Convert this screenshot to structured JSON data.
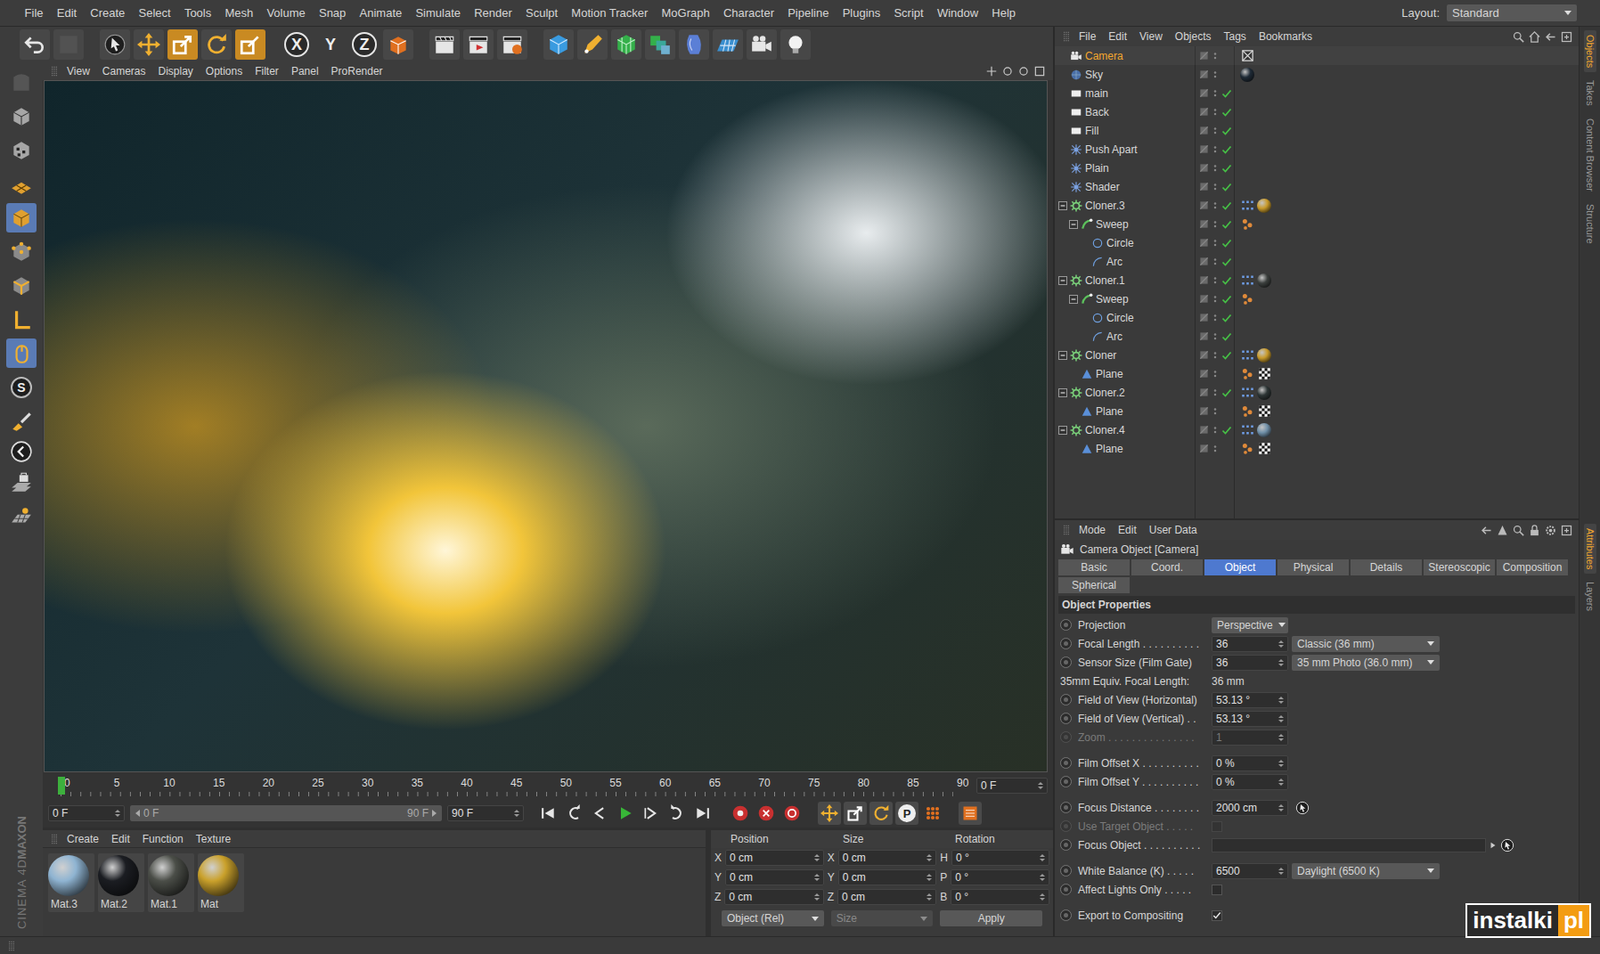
{
  "menubar": {
    "items": [
      "File",
      "Edit",
      "Create",
      "Select",
      "Tools",
      "Mesh",
      "Volume",
      "Snap",
      "Animate",
      "Simulate",
      "Render",
      "Sculpt",
      "Motion Tracker",
      "MoGraph",
      "Character",
      "Pipeline",
      "Plugins",
      "Script",
      "Window",
      "Help"
    ],
    "layout_label": "Layout:",
    "layout_value": "Standard"
  },
  "toolbar": {
    "tools": [
      {
        "highlighted": false
      },
      {
        "highlighted": false
      },
      {
        "highlighted": true
      },
      {
        "highlighted": false
      },
      {
        "highlighted": true
      }
    ],
    "axes": [
      {
        "label": "X",
        "active": true
      },
      {
        "label": "Y",
        "active": false
      },
      {
        "label": "Z",
        "active": true
      }
    ]
  },
  "left_toolbar": {
    "tools": [
      {
        "selected": false
      },
      {
        "selected": false
      },
      {
        "selected": false
      },
      {
        "selected": false
      },
      {
        "selected": true
      },
      {
        "selected": false
      },
      {
        "selected": false
      },
      {
        "selected": false
      },
      {
        "selected": true
      },
      {
        "selected": false
      },
      {
        "selected": false
      },
      {
        "selected": false
      },
      {
        "selected": false
      }
    ],
    "snap_label": "S"
  },
  "viewport": {
    "menu": [
      "View",
      "Cameras",
      "Display",
      "Options",
      "Filter",
      "Panel",
      "ProRender"
    ]
  },
  "timeline": {
    "ticks": [
      "0",
      "5",
      "10",
      "15",
      "20",
      "25",
      "30",
      "35",
      "40",
      "45",
      "50",
      "55",
      "60",
      "65",
      "70",
      "75",
      "80",
      "85",
      "90"
    ],
    "playhead": 0,
    "current_frame": "0 F"
  },
  "playback": {
    "start": "0 F",
    "range_start": "0 F",
    "range_end": "90 F",
    "end": "90 F",
    "range_level": 1,
    "param_label": "P"
  },
  "materials": {
    "menu": [
      "Create",
      "Edit",
      "Function",
      "Texture"
    ],
    "items": [
      {
        "name": "Mat.3",
        "color": "#8fb4d2"
      },
      {
        "name": "Mat.2",
        "color": "#1b1d22"
      },
      {
        "name": "Mat.1",
        "color": "#4b4e48"
      },
      {
        "name": "Mat",
        "color": "#caa12b"
      }
    ]
  },
  "coordinates": {
    "headers": [
      "Position",
      "Size",
      "Rotation"
    ],
    "rows": [
      {
        "axis": "X",
        "position": "0 cm",
        "size_axis": "X",
        "size": "0 cm",
        "rotation_axis": "H",
        "rotation": "0 °"
      },
      {
        "axis": "Y",
        "position": "0 cm",
        "size_axis": "Y",
        "size": "0 cm",
        "rotation_axis": "P",
        "rotation": "0 °"
      },
      {
        "axis": "Z",
        "position": "0 cm",
        "size_axis": "Z",
        "size": "0 cm",
        "rotation_axis": "B",
        "rotation": "0 °"
      }
    ],
    "mode": "Object (Rel)",
    "size_mode": "Size",
    "size_mode_disabled": true,
    "apply": "Apply"
  },
  "object_manager": {
    "menu": [
      "File",
      "Edit",
      "View",
      "Objects",
      "Tags",
      "Bookmarks"
    ],
    "objects": [
      {
        "name": "Camera",
        "depth": 0,
        "kind": "camera",
        "expandable": false,
        "expanded": false,
        "selected": true,
        "enabled": false,
        "tags": [
          {
            "kind": "protection"
          }
        ]
      },
      {
        "name": "Sky",
        "depth": 0,
        "kind": "sky",
        "expandable": false,
        "expanded": false,
        "selected": false,
        "enabled": false,
        "tags": [
          {
            "kind": "material",
            "color": "#1e2a36"
          }
        ]
      },
      {
        "name": "main",
        "depth": 0,
        "kind": "light",
        "expandable": false,
        "expanded": false,
        "selected": false,
        "enabled": true,
        "tags": []
      },
      {
        "name": "Back",
        "depth": 0,
        "kind": "light",
        "expandable": false,
        "expanded": false,
        "selected": false,
        "enabled": true,
        "tags": []
      },
      {
        "name": "Fill",
        "depth": 0,
        "kind": "light",
        "expandable": false,
        "expanded": false,
        "selected": false,
        "enabled": true,
        "tags": []
      },
      {
        "name": "Push Apart",
        "depth": 0,
        "kind": "effector",
        "expandable": false,
        "expanded": false,
        "selected": false,
        "enabled": true,
        "tags": []
      },
      {
        "name": "Plain",
        "depth": 0,
        "kind": "effector",
        "expandable": false,
        "expanded": false,
        "selected": false,
        "enabled": true,
        "tags": []
      },
      {
        "name": "Shader",
        "depth": 0,
        "kind": "effector",
        "expandable": false,
        "expanded": false,
        "selected": false,
        "enabled": true,
        "tags": []
      },
      {
        "name": "Cloner.3",
        "depth": 0,
        "kind": "cloner",
        "expandable": true,
        "expanded": true,
        "selected": false,
        "enabled": true,
        "tags": [
          {
            "kind": "selection"
          },
          {
            "kind": "material",
            "color": "#c89a2a"
          }
        ]
      },
      {
        "name": "Sweep",
        "depth": 1,
        "kind": "sweep",
        "expandable": true,
        "expanded": true,
        "selected": false,
        "enabled": true,
        "tags": [
          {
            "kind": "phong"
          }
        ]
      },
      {
        "name": "Circle",
        "depth": 2,
        "kind": "circle",
        "expandable": false,
        "expanded": false,
        "selected": false,
        "enabled": true,
        "tags": []
      },
      {
        "name": "Arc",
        "depth": 2,
        "kind": "arc",
        "expandable": false,
        "expanded": false,
        "selected": false,
        "enabled": true,
        "tags": []
      },
      {
        "name": "Cloner.1",
        "depth": 0,
        "kind": "cloner",
        "expandable": true,
        "expanded": true,
        "selected": false,
        "enabled": true,
        "tags": [
          {
            "kind": "selection"
          },
          {
            "kind": "material",
            "color": "#3b3f3d"
          }
        ]
      },
      {
        "name": "Sweep",
        "depth": 1,
        "kind": "sweep",
        "expandable": true,
        "expanded": true,
        "selected": false,
        "enabled": true,
        "tags": [
          {
            "kind": "phong"
          }
        ]
      },
      {
        "name": "Circle",
        "depth": 2,
        "kind": "circle",
        "expandable": false,
        "expanded": false,
        "selected": false,
        "enabled": true,
        "tags": []
      },
      {
        "name": "Arc",
        "depth": 2,
        "kind": "arc",
        "expandable": false,
        "expanded": false,
        "selected": false,
        "enabled": true,
        "tags": []
      },
      {
        "name": "Cloner",
        "depth": 0,
        "kind": "cloner",
        "expandable": true,
        "expanded": true,
        "selected": false,
        "enabled": true,
        "tags": [
          {
            "kind": "selection"
          },
          {
            "kind": "material",
            "color": "#c89a2a"
          }
        ]
      },
      {
        "name": "Plane",
        "depth": 1,
        "kind": "plane",
        "expandable": false,
        "expanded": false,
        "selected": false,
        "enabled": false,
        "tags": [
          {
            "kind": "phong"
          },
          {
            "kind": "texture"
          }
        ]
      },
      {
        "name": "Cloner.2",
        "depth": 0,
        "kind": "cloner",
        "expandable": true,
        "expanded": true,
        "selected": false,
        "enabled": true,
        "tags": [
          {
            "kind": "selection"
          },
          {
            "kind": "material",
            "color": "#2d3535"
          }
        ]
      },
      {
        "name": "Plane",
        "depth": 1,
        "kind": "plane",
        "expandable": false,
        "expanded": false,
        "selected": false,
        "enabled": false,
        "tags": [
          {
            "kind": "phong"
          },
          {
            "kind": "texture"
          }
        ]
      },
      {
        "name": "Cloner.4",
        "depth": 0,
        "kind": "cloner",
        "expandable": true,
        "expanded": true,
        "selected": false,
        "enabled": true,
        "tags": [
          {
            "kind": "selection"
          },
          {
            "kind": "material",
            "color": "#6f8fa8"
          }
        ]
      },
      {
        "name": "Plane",
        "depth": 1,
        "kind": "plane",
        "expandable": false,
        "expanded": false,
        "selected": false,
        "enabled": false,
        "tags": [
          {
            "kind": "phong"
          },
          {
            "kind": "texture"
          }
        ]
      }
    ]
  },
  "side_tabs_top": [
    {
      "label": "Objects",
      "selected": true
    },
    {
      "label": "Takes",
      "selected": false
    },
    {
      "label": "Content Browser",
      "selected": false
    },
    {
      "label": "Structure",
      "selected": false
    }
  ],
  "side_tabs_bottom": [
    {
      "label": "Attributes",
      "selected": true
    },
    {
      "label": "Layers",
      "selected": false
    }
  ],
  "attributes": {
    "menu": [
      "Mode",
      "Edit",
      "User Data"
    ],
    "title": "Camera Object [Camera]",
    "tabs": [
      {
        "label": "Basic",
        "selected": false
      },
      {
        "label": "Coord.",
        "selected": false
      },
      {
        "label": "Object",
        "selected": true
      },
      {
        "label": "Physical",
        "selected": false
      },
      {
        "label": "Details",
        "selected": false
      },
      {
        "label": "Stereoscopic",
        "selected": false
      },
      {
        "label": "Composition",
        "selected": false
      },
      {
        "label": "Spherical",
        "selected": false
      }
    ],
    "section": "Object Properties",
    "groups": [
      [
        {
          "kind": "dropdown",
          "label": "Projection",
          "value": "Perspective",
          "disabled": false
        },
        {
          "kind": "number-preset",
          "label": "Focal Length . . . . . . . . . .",
          "value": "36",
          "preset": "Classic (36 mm)",
          "disabled": false
        },
        {
          "kind": "number-preset",
          "label": "Sensor Size (Film Gate)",
          "value": "36",
          "preset": "35 mm Photo (36.0 mm)",
          "disabled": false
        },
        {
          "kind": "static",
          "label": "35mm Equiv. Focal Length:",
          "value": "36 mm",
          "disabled": false
        },
        {
          "kind": "number",
          "label": "Field of View (Horizontal)",
          "value": "53.13 °",
          "disabled": false
        },
        {
          "kind": "number",
          "label": "Field of View (Vertical) . .",
          "value": "53.13 °",
          "disabled": false
        },
        {
          "kind": "number",
          "label": "Zoom . . . . . . . . . . . . . . .",
          "value": "1",
          "disabled": true
        }
      ],
      [
        {
          "kind": "number",
          "label": "Film Offset X . . . . . . . . . .",
          "value": "0 %",
          "disabled": false
        },
        {
          "kind": "number",
          "label": "Film Offset Y . . . . . . . . . .",
          "value": "0 %",
          "disabled": false
        }
      ],
      [
        {
          "kind": "number-pick",
          "label": "Focus Distance . . . . . . . .",
          "value": "2000 cm",
          "disabled": false
        },
        {
          "kind": "checkbox",
          "label": "Use Target Object . . . . .",
          "checked": false,
          "disabled": true
        },
        {
          "kind": "link",
          "label": "Focus Object . . . . . . . . . .",
          "disabled": false
        }
      ],
      [
        {
          "kind": "number-preset",
          "label": "White Balance (K) . . . . .",
          "value": "6500",
          "preset": "Daylight (6500 K)",
          "disabled": false
        },
        {
          "kind": "checkbox",
          "label": "Affect Lights Only . . . . .",
          "checked": false,
          "disabled": false
        }
      ],
      [
        {
          "kind": "checkbox",
          "label": "Export to Compositing",
          "checked": true,
          "disabled": false
        }
      ]
    ]
  },
  "logo": {
    "brand": "MAXON",
    "product": "CINEMA 4D"
  },
  "watermark": {
    "text": "instalki",
    "suffix": "pl"
  }
}
